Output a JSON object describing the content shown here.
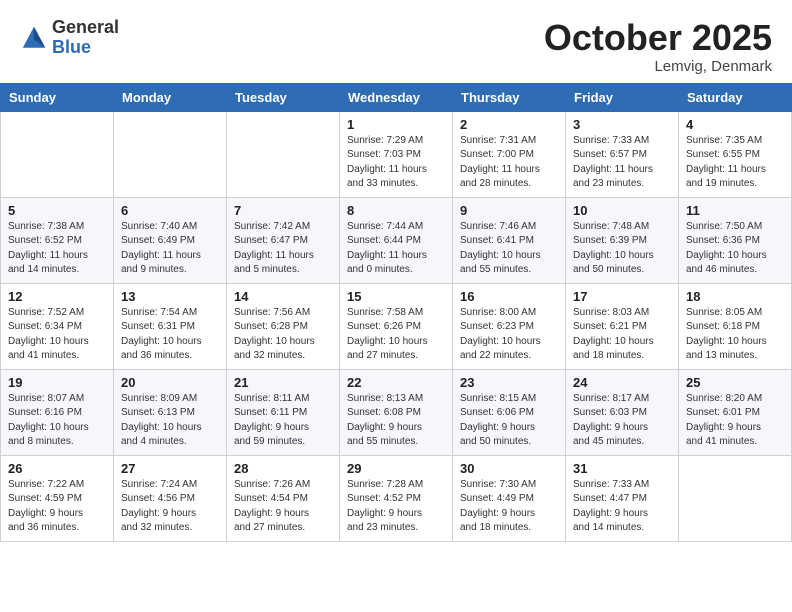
{
  "logo": {
    "general": "General",
    "blue": "Blue"
  },
  "title": "October 2025",
  "location": "Lemvig, Denmark",
  "days_of_week": [
    "Sunday",
    "Monday",
    "Tuesday",
    "Wednesday",
    "Thursday",
    "Friday",
    "Saturday"
  ],
  "weeks": [
    [
      {
        "day": "",
        "info": ""
      },
      {
        "day": "",
        "info": ""
      },
      {
        "day": "",
        "info": ""
      },
      {
        "day": "1",
        "info": "Sunrise: 7:29 AM\nSunset: 7:03 PM\nDaylight: 11 hours\nand 33 minutes."
      },
      {
        "day": "2",
        "info": "Sunrise: 7:31 AM\nSunset: 7:00 PM\nDaylight: 11 hours\nand 28 minutes."
      },
      {
        "day": "3",
        "info": "Sunrise: 7:33 AM\nSunset: 6:57 PM\nDaylight: 11 hours\nand 23 minutes."
      },
      {
        "day": "4",
        "info": "Sunrise: 7:35 AM\nSunset: 6:55 PM\nDaylight: 11 hours\nand 19 minutes."
      }
    ],
    [
      {
        "day": "5",
        "info": "Sunrise: 7:38 AM\nSunset: 6:52 PM\nDaylight: 11 hours\nand 14 minutes."
      },
      {
        "day": "6",
        "info": "Sunrise: 7:40 AM\nSunset: 6:49 PM\nDaylight: 11 hours\nand 9 minutes."
      },
      {
        "day": "7",
        "info": "Sunrise: 7:42 AM\nSunset: 6:47 PM\nDaylight: 11 hours\nand 5 minutes."
      },
      {
        "day": "8",
        "info": "Sunrise: 7:44 AM\nSunset: 6:44 PM\nDaylight: 11 hours\nand 0 minutes."
      },
      {
        "day": "9",
        "info": "Sunrise: 7:46 AM\nSunset: 6:41 PM\nDaylight: 10 hours\nand 55 minutes."
      },
      {
        "day": "10",
        "info": "Sunrise: 7:48 AM\nSunset: 6:39 PM\nDaylight: 10 hours\nand 50 minutes."
      },
      {
        "day": "11",
        "info": "Sunrise: 7:50 AM\nSunset: 6:36 PM\nDaylight: 10 hours\nand 46 minutes."
      }
    ],
    [
      {
        "day": "12",
        "info": "Sunrise: 7:52 AM\nSunset: 6:34 PM\nDaylight: 10 hours\nand 41 minutes."
      },
      {
        "day": "13",
        "info": "Sunrise: 7:54 AM\nSunset: 6:31 PM\nDaylight: 10 hours\nand 36 minutes."
      },
      {
        "day": "14",
        "info": "Sunrise: 7:56 AM\nSunset: 6:28 PM\nDaylight: 10 hours\nand 32 minutes."
      },
      {
        "day": "15",
        "info": "Sunrise: 7:58 AM\nSunset: 6:26 PM\nDaylight: 10 hours\nand 27 minutes."
      },
      {
        "day": "16",
        "info": "Sunrise: 8:00 AM\nSunset: 6:23 PM\nDaylight: 10 hours\nand 22 minutes."
      },
      {
        "day": "17",
        "info": "Sunrise: 8:03 AM\nSunset: 6:21 PM\nDaylight: 10 hours\nand 18 minutes."
      },
      {
        "day": "18",
        "info": "Sunrise: 8:05 AM\nSunset: 6:18 PM\nDaylight: 10 hours\nand 13 minutes."
      }
    ],
    [
      {
        "day": "19",
        "info": "Sunrise: 8:07 AM\nSunset: 6:16 PM\nDaylight: 10 hours\nand 8 minutes."
      },
      {
        "day": "20",
        "info": "Sunrise: 8:09 AM\nSunset: 6:13 PM\nDaylight: 10 hours\nand 4 minutes."
      },
      {
        "day": "21",
        "info": "Sunrise: 8:11 AM\nSunset: 6:11 PM\nDaylight: 9 hours\nand 59 minutes."
      },
      {
        "day": "22",
        "info": "Sunrise: 8:13 AM\nSunset: 6:08 PM\nDaylight: 9 hours\nand 55 minutes."
      },
      {
        "day": "23",
        "info": "Sunrise: 8:15 AM\nSunset: 6:06 PM\nDaylight: 9 hours\nand 50 minutes."
      },
      {
        "day": "24",
        "info": "Sunrise: 8:17 AM\nSunset: 6:03 PM\nDaylight: 9 hours\nand 45 minutes."
      },
      {
        "day": "25",
        "info": "Sunrise: 8:20 AM\nSunset: 6:01 PM\nDaylight: 9 hours\nand 41 minutes."
      }
    ],
    [
      {
        "day": "26",
        "info": "Sunrise: 7:22 AM\nSunset: 4:59 PM\nDaylight: 9 hours\nand 36 minutes."
      },
      {
        "day": "27",
        "info": "Sunrise: 7:24 AM\nSunset: 4:56 PM\nDaylight: 9 hours\nand 32 minutes."
      },
      {
        "day": "28",
        "info": "Sunrise: 7:26 AM\nSunset: 4:54 PM\nDaylight: 9 hours\nand 27 minutes."
      },
      {
        "day": "29",
        "info": "Sunrise: 7:28 AM\nSunset: 4:52 PM\nDaylight: 9 hours\nand 23 minutes."
      },
      {
        "day": "30",
        "info": "Sunrise: 7:30 AM\nSunset: 4:49 PM\nDaylight: 9 hours\nand 18 minutes."
      },
      {
        "day": "31",
        "info": "Sunrise: 7:33 AM\nSunset: 4:47 PM\nDaylight: 9 hours\nand 14 minutes."
      },
      {
        "day": "",
        "info": ""
      }
    ]
  ]
}
